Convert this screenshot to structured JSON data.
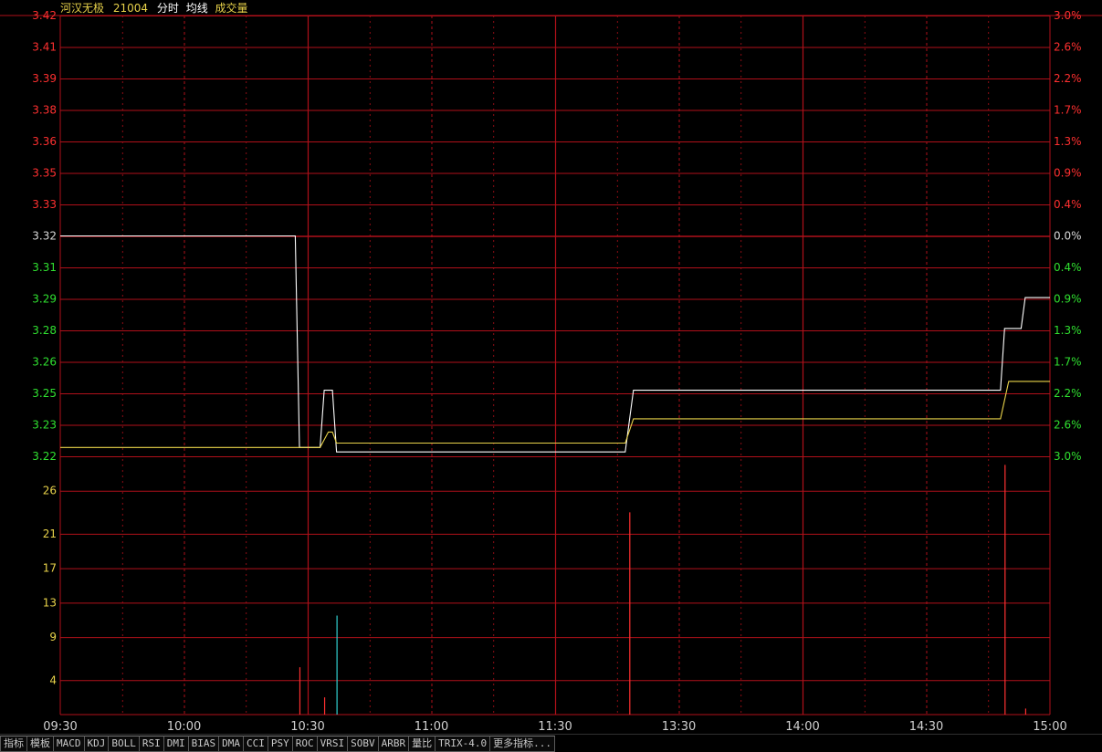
{
  "header": {
    "name": "河汉无极",
    "code": "21004",
    "mode": "分时",
    "avg_label": "均线",
    "vol_label": "成交量"
  },
  "colors": {
    "grid": "#b0101a",
    "price_line": "#ffffff",
    "avg_line": "#e8d24a",
    "up": "#ff3030",
    "down": "#30e030",
    "neutral": "#d8d8d8",
    "vol_label": "#e8d24a",
    "vol_up": "#ff3030",
    "vol_down": "#30d0d0",
    "text": "#d0d0d0"
  },
  "chart_data": {
    "type": "line",
    "prev_close": 3.32,
    "price_axis": {
      "ticks": [
        "3.42",
        "3.41",
        "3.39",
        "3.38",
        "3.36",
        "3.35",
        "3.33",
        "3.32",
        "3.31",
        "3.29",
        "3.28",
        "3.26",
        "3.25",
        "3.23",
        "3.22"
      ],
      "ylim": [
        3.22,
        3.42
      ]
    },
    "pct_axis": {
      "ticks": [
        "3.0%",
        "2.6%",
        "2.2%",
        "1.7%",
        "1.3%",
        "0.9%",
        "0.4%",
        "0.0%",
        "0.4%",
        "0.9%",
        "1.3%",
        "1.7%",
        "2.2%",
        "2.6%",
        "3.0%"
      ]
    },
    "volume_axis": {
      "ticks": [
        "26",
        "21",
        "17",
        "13",
        "9",
        "4"
      ],
      "ylim": [
        0,
        30
      ]
    },
    "time_axis": {
      "ticks": [
        "09:30",
        "10:00",
        "10:30",
        "11:00",
        "11:30",
        "13:30",
        "14:00",
        "14:30",
        "15:00"
      ],
      "range_minutes": [
        0,
        240
      ]
    },
    "series": [
      {
        "points": [
          [
            0,
            3.32
          ],
          [
            57,
            3.32
          ],
          [
            58,
            3.224
          ],
          [
            63,
            3.224
          ],
          [
            64,
            3.25
          ],
          [
            66,
            3.25
          ],
          [
            67,
            3.222
          ],
          [
            137,
            3.222
          ],
          [
            139,
            3.25
          ],
          [
            228,
            3.25
          ],
          [
            229,
            3.278
          ],
          [
            233,
            3.278
          ],
          [
            234,
            3.292
          ],
          [
            240,
            3.292
          ]
        ]
      },
      {
        "points": [
          [
            0,
            3.224
          ],
          [
            63,
            3.224
          ],
          [
            65,
            3.231
          ],
          [
            66,
            3.231
          ],
          [
            67,
            3.226
          ],
          [
            137,
            3.226
          ],
          [
            139,
            3.237
          ],
          [
            228,
            3.237
          ],
          [
            230,
            3.254
          ],
          [
            240,
            3.254
          ]
        ]
      }
    ],
    "volumes": [
      {
        "t": 58,
        "v": 5.5,
        "dir": "up"
      },
      {
        "t": 64,
        "v": 2,
        "dir": "up"
      },
      {
        "t": 67,
        "v": 11.5,
        "dir": "down"
      },
      {
        "t": 138,
        "v": 23.5,
        "dir": "up"
      },
      {
        "t": 229,
        "v": 29,
        "dir": "up"
      },
      {
        "t": 234,
        "v": 0.7,
        "dir": "up"
      }
    ]
  },
  "tabs": [
    "指标",
    "模板",
    "MACD",
    "KDJ",
    "BOLL",
    "RSI",
    "DMI",
    "BIAS",
    "DMA",
    "CCI",
    "PSY",
    "ROC",
    "VRSI",
    "SOBV",
    "ARBR",
    "量比",
    "TRIX-4.0",
    "更多指标..."
  ]
}
